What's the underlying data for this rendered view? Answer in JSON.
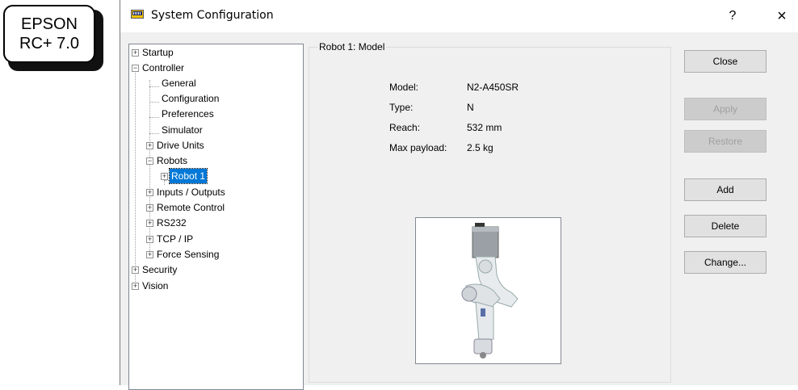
{
  "badge": {
    "line1": "EPSON",
    "line2": "RC+ 7.0"
  },
  "window": {
    "title": "System Configuration",
    "help": "?",
    "close": "×"
  },
  "tree": {
    "startup": "Startup",
    "controller": "Controller",
    "general": "General",
    "configuration": "Configuration",
    "preferences": "Preferences",
    "simulator": "Simulator",
    "drive_units": "Drive Units",
    "robots": "Robots",
    "robot1": "Robot 1",
    "inputs_outputs": "Inputs / Outputs",
    "remote_control": "Remote Control",
    "rs232": "RS232",
    "tcp_ip": "TCP / IP",
    "force_sensing": "Force Sensing",
    "security": "Security",
    "vision": "Vision",
    "selected": "Robot 1"
  },
  "panel": {
    "title": "Robot 1: Model",
    "fields": [
      {
        "label": "Model:",
        "value": "N2-A450SR"
      },
      {
        "label": "Type:",
        "value": "N"
      },
      {
        "label": "Reach:",
        "value": "532 mm"
      },
      {
        "label": "Max payload:",
        "value": "2.5 kg"
      }
    ]
  },
  "buttons": {
    "close": "Close",
    "apply": "Apply",
    "restore": "Restore",
    "add": "Add",
    "delete": "Delete",
    "change": "Change..."
  },
  "colors": {
    "selection": "#0078d7",
    "window_bg": "#f0f0f0",
    "disabled_text": "#a0a0a0"
  },
  "icons": {
    "title": "monitor-icon",
    "expand": "plus-box-icon",
    "collapse": "minus-box-icon"
  }
}
